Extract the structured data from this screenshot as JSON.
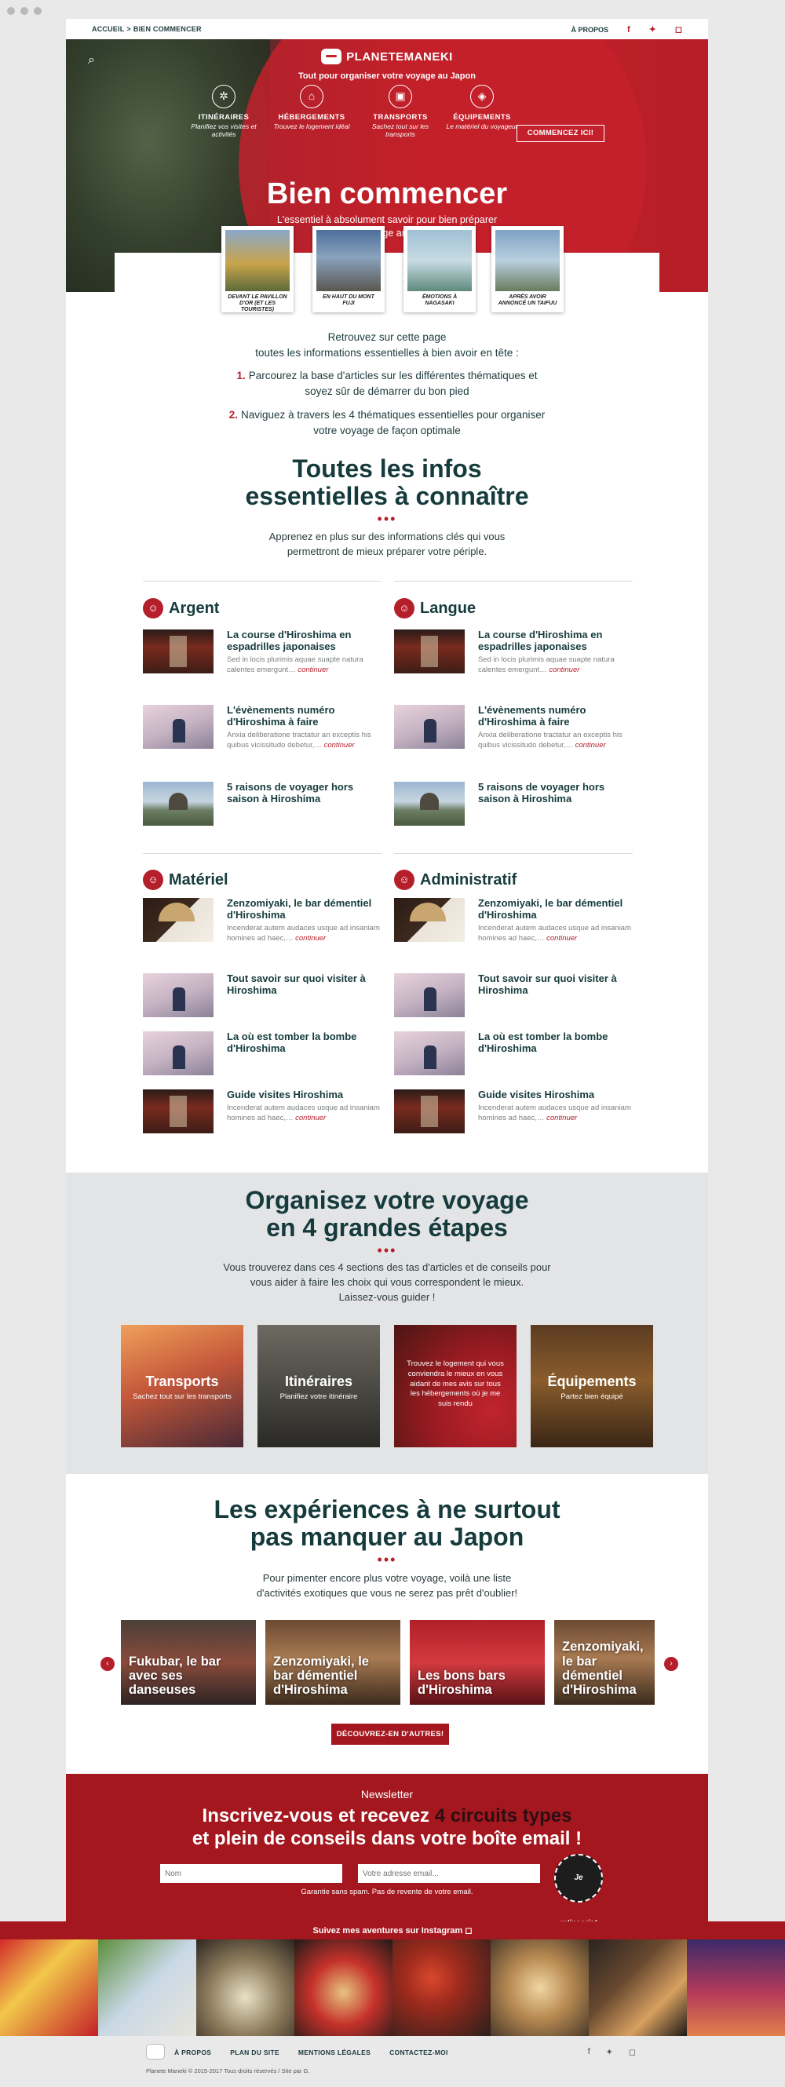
{
  "topbar": {
    "breadcrumb": [
      "ACCUEIL",
      "BIEN COMMENCER"
    ],
    "breadcrumb_sep": ">",
    "about": "À PROPOS",
    "social": [
      "f",
      "t",
      "ig"
    ]
  },
  "hero": {
    "brand": "PLANETEMANEKI",
    "tagline": "Tout pour organiser votre voyage au Japon",
    "nav": [
      {
        "icon": "compass",
        "title": "ITINÉRAIRES",
        "subtitle": "Planifiez vos visites et activités"
      },
      {
        "icon": "bed",
        "title": "HÉBERGEMENTS",
        "subtitle": "Trouvez le logement idéal"
      },
      {
        "icon": "train",
        "title": "TRANSPORTS",
        "subtitle": "Sachez tout sur les transports"
      },
      {
        "icon": "backpack",
        "title": "ÉQUIPEMENTS",
        "subtitle": "Le matériel du voyageur"
      }
    ],
    "cta": "COMMENCEZ ICI!",
    "title": "Bien commencer",
    "lead": "L'essentiel à absolument savoir pour bien préparer votre voyage au Japon",
    "polaroids": [
      {
        "caption": "DEVANT LE PAVILLON D'OR (ET LES TOURISTES)",
        "color": "#c9a44b"
      },
      {
        "caption": "EN HAUT DU MONT FUJI",
        "color": "#5c7fa3"
      },
      {
        "caption": "ÉMOTIONS À NAGASAKI",
        "color": "#7fa3a8"
      },
      {
        "caption": "APRÈS AVOIR ANNONCÉ UN TAIFUU",
        "color": "#6e8fb0"
      }
    ]
  },
  "intro": {
    "line1": "Retrouvez sur cette page",
    "line2": "toutes les informations essentielles à bien avoir en tête :",
    "steps": [
      {
        "n": "1.",
        "text": "Parcourez la base d'articles sur les différentes thématiques et soyez sûr de démarrer du bon pied"
      },
      {
        "n": "2.",
        "text": "Naviguez à travers les 4 thématiques essentielles pour organiser votre voyage de façon optimale"
      }
    ]
  },
  "essentials": {
    "title_l1": "Toutes les infos",
    "title_l2": "essentielles à connaître",
    "dots": "•••",
    "sub_l1": "Apprenez en plus sur des informations clés qui vous",
    "sub_l2": "permettront de mieux préparer votre périple.",
    "more": "continuer",
    "categories": [
      {
        "name": "Argent",
        "articles": [
          {
            "title": "La course d'Hiroshima en espadrilles japonaises",
            "excerpt": "Sed in locis plurimis aquae suapte natura calentes emergunt…",
            "thumb": "torii"
          },
          {
            "title": "L'évènements numéro d'Hiroshima à faire",
            "excerpt": "Anxia deliberatione tractatur an exceptis his quibus vicissitudo debetur,…",
            "thumb": "blossom"
          },
          {
            "title": "5 raisons de voyager hors saison à Hiroshima",
            "excerpt": "",
            "thumb": "dome"
          }
        ]
      },
      {
        "name": "Langue",
        "articles": [
          {
            "title": "La course d'Hiroshima en espadrilles japonaises",
            "excerpt": "Sed in locis plurimis aquae suapte natura calentes emergunt…",
            "thumb": "torii"
          },
          {
            "title": "L'évènements numéro d'Hiroshima à faire",
            "excerpt": "Anxia deliberatione tractatur an exceptis his quibus vicissitudo debetur,…",
            "thumb": "blossom"
          },
          {
            "title": "5 raisons de voyager hors saison à Hiroshima",
            "excerpt": "",
            "thumb": "dome"
          }
        ]
      },
      {
        "name": "Matériel",
        "articles": [
          {
            "title": "Zenzomiyaki, le bar démentiel d'Hiroshima",
            "excerpt": "Incenderat autem audaces usque ad insaniam homines ad haec,…",
            "thumb": "umbrella"
          },
          {
            "title": "Tout savoir sur quoi visiter à Hiroshima",
            "excerpt": "",
            "thumb": "blossom"
          },
          {
            "title": "La où est tomber la bombe d'Hiroshima",
            "excerpt": "",
            "thumb": "blossom"
          },
          {
            "title": "Guide visites Hiroshima",
            "excerpt": "Incenderat autem audaces usque ad insaniam homines ad haec,…",
            "thumb": "torii"
          }
        ]
      },
      {
        "name": "Administratif",
        "articles": [
          {
            "title": "Zenzomiyaki, le bar démentiel d'Hiroshima",
            "excerpt": "Incenderat autem audaces usque ad insaniam homines ad haec,…",
            "thumb": "umbrella"
          },
          {
            "title": "Tout savoir sur quoi visiter à Hiroshima",
            "excerpt": "",
            "thumb": "blossom"
          },
          {
            "title": "La où est tomber la bombe d'Hiroshima",
            "excerpt": "",
            "thumb": "blossom"
          },
          {
            "title": "Guide visites Hiroshima",
            "excerpt": "Incenderat autem audaces usque ad insaniam homines ad haec,…",
            "thumb": "torii"
          }
        ]
      }
    ]
  },
  "steps_section": {
    "title_l1": "Organisez votre voyage",
    "title_l2": "en 4 grandes étapes",
    "dots": "•••",
    "sub_l1": "Vous trouverez dans ces 4 sections des tas d'articles et de conseils pour",
    "sub_l2": "vous aider à faire les choix qui vous correspondent le mieux.",
    "sub_l3": "Laissez-vous guider !",
    "cards": [
      {
        "title": "Transports",
        "subtitle": "Sachez tout sur les transports",
        "paragraph": ""
      },
      {
        "title": "Itinéraires",
        "subtitle": "Planifiez votre itinéraire",
        "paragraph": ""
      },
      {
        "title": "",
        "subtitle": "",
        "paragraph": "Trouvez le logement qui vous conviendra le mieux en vous aidant de mes avis sur tous les hébergements où je me suis rendu"
      },
      {
        "title": "Équipements",
        "subtitle": "Partez bien équipé",
        "paragraph": ""
      }
    ]
  },
  "experiences": {
    "title_l1": "Les expériences à ne surtout",
    "title_l2": "pas manquer au Japon",
    "dots": "•••",
    "sub_l1": "Pour pimenter encore plus votre voyage, voilà une liste",
    "sub_l2": "d'activités exotiques que vous ne serez pas prêt d'oublier!",
    "cards": [
      {
        "title": "Fukubar, le bar avec ses danseuses"
      },
      {
        "title": "Zenzomiyaki, le bar démentiel d'Hiroshima"
      },
      {
        "title": "Les bons bars d'Hiroshima"
      },
      {
        "title": "Zenzomiyaki, le bar démentiel d'Hiroshima"
      }
    ],
    "prev": "‹",
    "next": "›",
    "more_button": "DÉCOUVREZ-EN D'AUTRES!"
  },
  "newsletter": {
    "label": "Newsletter",
    "heading_a": "Inscrivez-vous et recevez ",
    "heading_b": "4 circuits types",
    "heading_c": "et plein de conseils dans votre boîte email !",
    "name_placeholder": "Nom",
    "email_placeholder": "Votre adresse email...",
    "note": "Garantie sans spam. Pas de revente de votre email.",
    "submit": "Je m'inscris!"
  },
  "instagram": {
    "label": "Suivez mes aventures sur Instagram"
  },
  "footer": {
    "links": [
      "À PROPOS",
      "PLAN DU SITE",
      "MENTIONS LÉGALES",
      "CONTACTEZ-MOI"
    ],
    "social": [
      "f",
      "t",
      "ig"
    ],
    "copyright": "Planete Maneki © 2015-2017 Tous droits réservés / Site par G."
  }
}
